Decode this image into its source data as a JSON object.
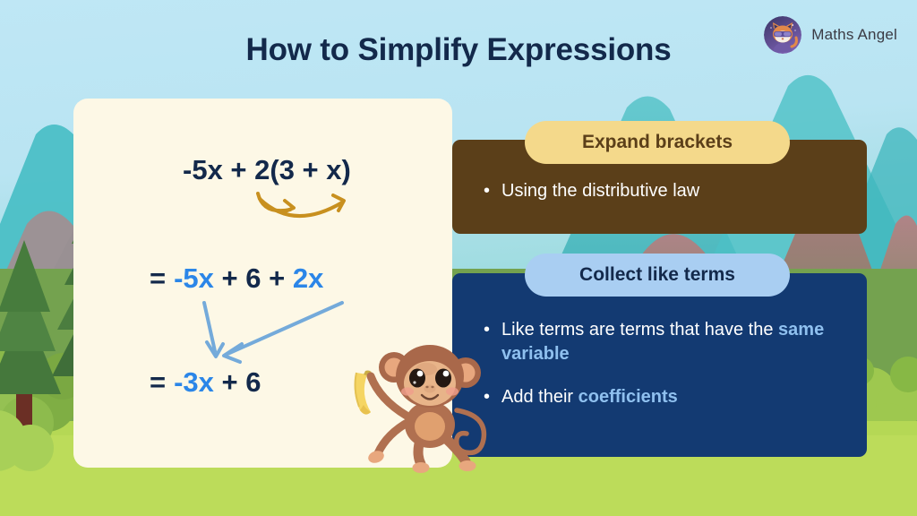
{
  "header": {
    "title": "How to Simplify Expressions",
    "brand_name": "Maths Angel",
    "brand_icon": "cat-logo-icon"
  },
  "card": {
    "equations": [
      {
        "id": "line-1",
        "parts": [
          {
            "text": "-5x + 2(3 + x)",
            "color": "navy"
          }
        ]
      },
      {
        "id": "line-2",
        "parts": [
          {
            "text": "=",
            "color": "navy"
          },
          {
            "text": "-5x",
            "color": "blue"
          },
          {
            "text": "+ 6 +",
            "color": "navy"
          },
          {
            "text": "2x",
            "color": "blue"
          }
        ]
      },
      {
        "id": "line-3",
        "parts": [
          {
            "text": "=",
            "color": "navy"
          },
          {
            "text": "-3x",
            "color": "blue"
          },
          {
            "text": "+ 6",
            "color": "navy"
          }
        ]
      }
    ],
    "line1_full": "-5x + 2(3 + x)",
    "line2_eq": "=",
    "line2_a": "-5x",
    "line2_mid": "+ 6 +",
    "line2_b": "2x",
    "line3_eq": "=",
    "line3_a": "-3x",
    "line3_mid": "+ 6",
    "annotations": {
      "gold_arrows": "distribute-arrows",
      "blue_arrows": "collect-arrows"
    },
    "mascot": "monkey-with-banana"
  },
  "steps": [
    {
      "pill_label": "Expand brackets",
      "pill_color": "#f4d98b",
      "panel_color": "#5b3f19",
      "bullets": [
        {
          "lead": "Using the distributive law",
          "highlight": "",
          "tail": ""
        }
      ]
    },
    {
      "pill_label": "Collect like terms",
      "pill_color": "#a9cef2",
      "panel_color": "#133a72",
      "bullets": [
        {
          "lead": "Like terms are terms that have the ",
          "highlight": "same variable",
          "tail": ""
        },
        {
          "lead": "Add their ",
          "highlight": "coefficients",
          "tail": ""
        }
      ]
    }
  ],
  "palette": {
    "navy_text": "#13294b",
    "blue_accent": "#2b86e8",
    "gold_arrow": "#c8901f",
    "blue_arrow": "#74aada",
    "card_bg": "#fdf8e6",
    "sky": "#bfe6f2",
    "grass": "#bcdc5a"
  },
  "scenery": {
    "elements": [
      "sky-gradient",
      "teal-mountains",
      "mauve-hills",
      "green-hills",
      "pine-trees",
      "bush",
      "grass-field"
    ]
  }
}
